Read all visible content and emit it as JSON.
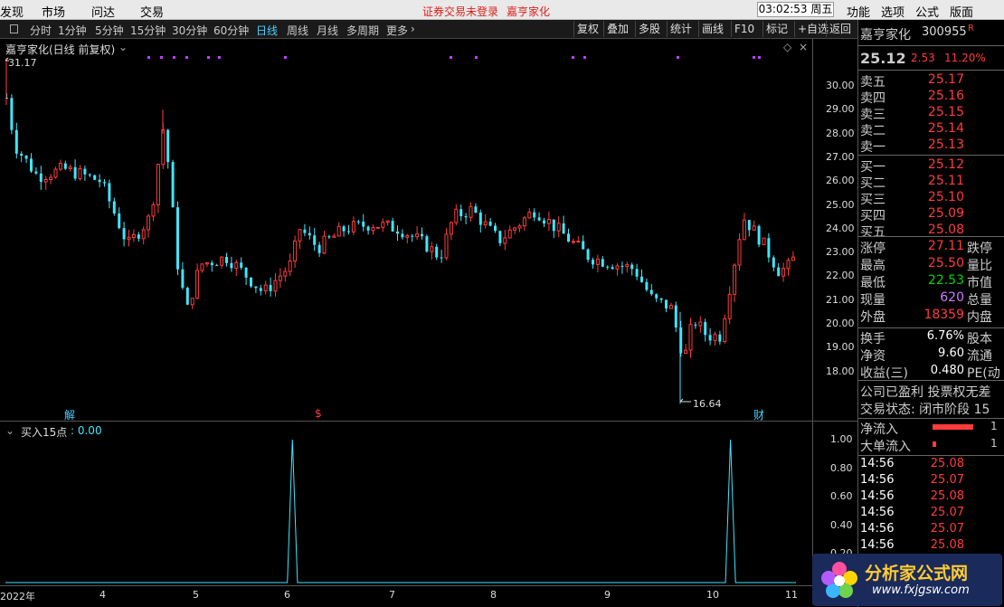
{
  "menu": {
    "items": [
      "发现",
      "市场",
      "问达",
      "交易"
    ],
    "warning": "证券交易未登录",
    "warning_stock": "嘉亨家化",
    "clock": "03:02:53 周五",
    "right_items": [
      "功能",
      "选项",
      "公式",
      "版面"
    ]
  },
  "toolbar": {
    "periods": [
      "分时",
      "1分钟",
      "5分钟",
      "15分钟",
      "30分钟",
      "60分钟",
      "日线",
      "周线",
      "月线",
      "多周期",
      "更多"
    ],
    "active": "日线",
    "buttons": [
      "复权",
      "叠加",
      "多股",
      "统计",
      "画线",
      "F10",
      "标记",
      "+自选",
      "返回"
    ]
  },
  "main": {
    "title": "嘉亨家化(日线 前复权)",
    "high_label": "31.17",
    "low_label": "16.64",
    "y_ticks": [
      "30.00",
      "29.00",
      "28.00",
      "27.00",
      "26.00",
      "25.00",
      "24.00",
      "23.00",
      "22.00",
      "21.00",
      "20.00",
      "19.00",
      "18.00"
    ],
    "events": [
      "解",
      "$",
      "财"
    ]
  },
  "sub": {
    "indicator_name": "买入15点",
    "indicator_value": ": 0.00",
    "y_ticks": [
      "1.00",
      "0.80",
      "0.60",
      "0.40",
      "0.20"
    ]
  },
  "x_axis": [
    "2022年",
    "4",
    "5",
    "6",
    "7",
    "8",
    "9",
    "10",
    "11"
  ],
  "chart_data": [
    {
      "type": "candlestick",
      "title": "嘉亨家化(日线 前复权)",
      "ylim": [
        16.5,
        31.5
      ],
      "high": 31.17,
      "low": 16.64
    },
    {
      "type": "line",
      "title": "买入15点",
      "ylim": [
        0,
        1.0
      ],
      "series": [
        {
          "name": "买入15点",
          "values": [
            0,
            0,
            0,
            0,
            0,
            0,
            0,
            0,
            0,
            0,
            0,
            0,
            0,
            0,
            0,
            0,
            0,
            0,
            0,
            0,
            0,
            0,
            0,
            0,
            0,
            0,
            0,
            0,
            0,
            0,
            0,
            0,
            0,
            0,
            0,
            0,
            0,
            0,
            0,
            0,
            0,
            0,
            0,
            0,
            0,
            0,
            0,
            0,
            0,
            0,
            0,
            0,
            0,
            0,
            0,
            0,
            0,
            1,
            0,
            0,
            0,
            0,
            0,
            0,
            0,
            0,
            0,
            0,
            0,
            0,
            0,
            0,
            0,
            0,
            0,
            0,
            0,
            0,
            0,
            0,
            0,
            0,
            0,
            0,
            0,
            0,
            0,
            0,
            0,
            0,
            0,
            0,
            0,
            0,
            0,
            0,
            0,
            0,
            0,
            0,
            0,
            0,
            0,
            0,
            0,
            0,
            0,
            0,
            0,
            0,
            0,
            0,
            0,
            0,
            0,
            0,
            0,
            0,
            0,
            0,
            0,
            0,
            0,
            0,
            0,
            0,
            0,
            0,
            0,
            0,
            0,
            0,
            0,
            0,
            0,
            0,
            0,
            0,
            0,
            0,
            0,
            0,
            0,
            0,
            1,
            0,
            0,
            0,
            0,
            0,
            0,
            0,
            0,
            0,
            0,
            0,
            0,
            0
          ]
        }
      ]
    }
  ],
  "panel": {
    "name": "嘉亨家化",
    "code": "300955",
    "code_flag": "R",
    "price": "25.12",
    "change": "2.53",
    "pct": "11.20%",
    "asks": [
      {
        "label": "卖五",
        "price": "25.17"
      },
      {
        "label": "卖四",
        "price": "25.16"
      },
      {
        "label": "卖三",
        "price": "25.15"
      },
      {
        "label": "卖二",
        "price": "25.14"
      },
      {
        "label": "卖一",
        "price": "25.13"
      }
    ],
    "bids": [
      {
        "label": "买一",
        "price": "25.12"
      },
      {
        "label": "买二",
        "price": "25.11"
      },
      {
        "label": "买三",
        "price": "25.10"
      },
      {
        "label": "买四",
        "price": "25.09"
      },
      {
        "label": "买五",
        "price": "25.08"
      }
    ],
    "stats": [
      {
        "label": "涨停",
        "value": "27.11",
        "label2": "跌停",
        "color": "red"
      },
      {
        "label": "最高",
        "value": "25.50",
        "label2": "量比",
        "color": "red"
      },
      {
        "label": "最低",
        "value": "22.53",
        "label2": "市值",
        "color": "green"
      },
      {
        "label": "现量",
        "value": "620",
        "label2": "总量",
        "color": "purple"
      },
      {
        "label": "外盘",
        "value": "18359",
        "label2": "内盘",
        "color": "red"
      }
    ],
    "stats2": [
      {
        "label": "换手",
        "value": "6.76%",
        "label2": "股本"
      },
      {
        "label": "净资",
        "value": "9.60",
        "label2": "流通"
      },
      {
        "label": "收益(三)",
        "value": "0.480",
        "label2": "PE(动"
      }
    ],
    "info1": "公司已盈利 投票权无差",
    "info2": "交易状态: 闭市阶段 15",
    "flow1": "净流入",
    "flow1_val": "1",
    "flow2": "大单流入",
    "flow2_val": "1",
    "ticks": [
      {
        "time": "14:56",
        "price": "25.08"
      },
      {
        "time": "14:56",
        "price": "25.07"
      },
      {
        "time": "14:56",
        "price": "25.08"
      },
      {
        "time": "14:56",
        "price": "25.07"
      },
      {
        "time": "14:56",
        "price": "25.07"
      },
      {
        "time": "14:56",
        "price": "25.08"
      }
    ]
  },
  "logo": {
    "text": "分析家公式网",
    "url": "www.fxjgsw.com"
  },
  "colors": {
    "up": "#ff3b3b",
    "down": "#3fe6ff",
    "accent": "#4ad0ff",
    "signal": "#3fe6ff"
  }
}
